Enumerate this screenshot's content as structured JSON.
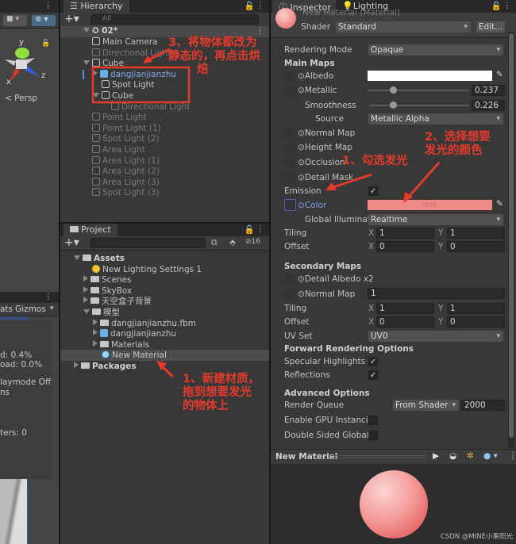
{
  "scene": {
    "axis_y": "y",
    "axis_x": "x",
    "axis_z": "z",
    "persp": "< Persp"
  },
  "game": {
    "stats_label": "ats",
    "gizmos_label": "Gizmos",
    "stat_lines": [
      "d: 0.4%",
      "oad: 0.0%",
      "laymode Off",
      "ns",
      "ters: 0"
    ]
  },
  "hierarchy": {
    "tab": "Hierarchy",
    "search_placeholder": "All",
    "scene": "02*",
    "items": [
      {
        "label": "Main Camera",
        "indent": 1,
        "state": "normal",
        "fold": ""
      },
      {
        "label": "Directional Light",
        "indent": 1,
        "state": "dim",
        "fold": ""
      },
      {
        "label": "Cube",
        "indent": 1,
        "state": "normal",
        "fold": "open"
      },
      {
        "label": "dangjianjianzhu",
        "indent": 2,
        "state": "prefab",
        "fold": "closed"
      },
      {
        "label": "Spot Light",
        "indent": 2,
        "state": "normal",
        "fold": ""
      },
      {
        "label": "Cube",
        "indent": 2,
        "state": "normal",
        "fold": "open"
      },
      {
        "label": "Directional Light",
        "indent": 3,
        "state": "dim",
        "fold": ""
      },
      {
        "label": "Point Light",
        "indent": 1,
        "state": "dim",
        "fold": ""
      },
      {
        "label": "Point Light (1)",
        "indent": 1,
        "state": "dim",
        "fold": ""
      },
      {
        "label": "Spot Light (2)",
        "indent": 1,
        "state": "dim",
        "fold": ""
      },
      {
        "label": "Area Light",
        "indent": 1,
        "state": "dim",
        "fold": ""
      },
      {
        "label": "Area Light (1)",
        "indent": 1,
        "state": "dim",
        "fold": ""
      },
      {
        "label": "Area Light (2)",
        "indent": 1,
        "state": "dim",
        "fold": ""
      },
      {
        "label": "Area Light (3)",
        "indent": 1,
        "state": "dim",
        "fold": ""
      },
      {
        "label": "Spot Light (3)",
        "indent": 1,
        "state": "dim",
        "fold": ""
      }
    ]
  },
  "project": {
    "tab": "Project",
    "hidden_count": "16",
    "items": [
      {
        "label": "Assets",
        "indent": 0,
        "icon": "folder-open",
        "fold": "open",
        "bold": true
      },
      {
        "label": "New Lighting Settings 1",
        "indent": 1,
        "icon": "lighting-settings",
        "fold": ""
      },
      {
        "label": "Scenes",
        "indent": 1,
        "icon": "folder",
        "fold": "closed"
      },
      {
        "label": "SkyBox",
        "indent": 1,
        "icon": "folder",
        "fold": "closed"
      },
      {
        "label": "天空盒子背景",
        "indent": 1,
        "icon": "folder",
        "fold": "closed"
      },
      {
        "label": "模型",
        "indent": 1,
        "icon": "folder-open",
        "fold": "open"
      },
      {
        "label": "dangjianjianzhu.fbm",
        "indent": 2,
        "icon": "folder",
        "fold": "closed"
      },
      {
        "label": "dangjianjianzhu",
        "indent": 2,
        "icon": "prefab",
        "fold": "closed"
      },
      {
        "label": "Materials",
        "indent": 2,
        "icon": "folder",
        "fold": "closed"
      },
      {
        "label": "New Material",
        "indent": 2,
        "icon": "material",
        "fold": "",
        "selected": true
      },
      {
        "label": "Packages",
        "indent": 0,
        "icon": "folder",
        "fold": "closed",
        "bold": true
      }
    ]
  },
  "inspector": {
    "tab": "Inspector",
    "tab2": "Lighting",
    "material_title": "New Material (Material)",
    "shader_label": "Shader",
    "shader_value": "Standard",
    "edit_button": "Edit...",
    "rendering_mode_label": "Rendering Mode",
    "rendering_mode": "Opaque",
    "main_maps": "Main Maps",
    "albedo": "Albedo",
    "albedo_color": "#ffffff",
    "metallic": "Metallic",
    "metallic_value": "0.237",
    "smoothness": "Smoothness",
    "smoothness_value": "0.226",
    "source": "Source",
    "source_value": "Metallic Alpha",
    "normal_map": "Normal Map",
    "height_map": "Height Map",
    "occlusion": "Occlusion",
    "detail_mask": "Detail Mask",
    "emission": "Emission",
    "emission_checked": true,
    "color": "Color",
    "emission_color": "#ef8a86",
    "hdr": "HDR",
    "gi_label": "Global Illuminatic",
    "gi_value": "Realtime",
    "tiling": "Tiling",
    "offset": "Offset",
    "x": "X",
    "y": "Y",
    "tiling_x": "1",
    "tiling_y": "1",
    "offset_x": "0",
    "offset_y": "0",
    "secondary_maps": "Secondary Maps",
    "detail_albedo": "Detail Albedo x2",
    "normal_map2": "Normal Map",
    "normal_map2_value": "1",
    "tiling2_x": "1",
    "tiling2_y": "1",
    "offset2_x": "0",
    "offset2_y": "0",
    "uv_set": "UV Set",
    "uv_value": "UV0",
    "forward": "Forward Rendering Options",
    "specular": "Specular Highlights",
    "reflections": "Reflections",
    "advanced": "Advanced Options",
    "render_queue": "Render Queue",
    "render_queue_mode": "From Shader",
    "render_queue_value": "2000",
    "gpu": "Enable GPU Instancin",
    "double_sided": "Double Sided Global Il",
    "preview_title": "New Material"
  },
  "annotations": {
    "step3": [
      "3、将物体都改为",
      "静态的，再点击烘",
      "焙"
    ],
    "step1_emission": "1、勾选发光",
    "step2": [
      "2、选择想要",
      "发光的颜色"
    ],
    "step1_material": [
      "1、新建材质，",
      "拖到想要发光",
      "的物体上"
    ],
    "color": "#e53a2c"
  },
  "watermark": "CSDN @MINE小果阳光"
}
